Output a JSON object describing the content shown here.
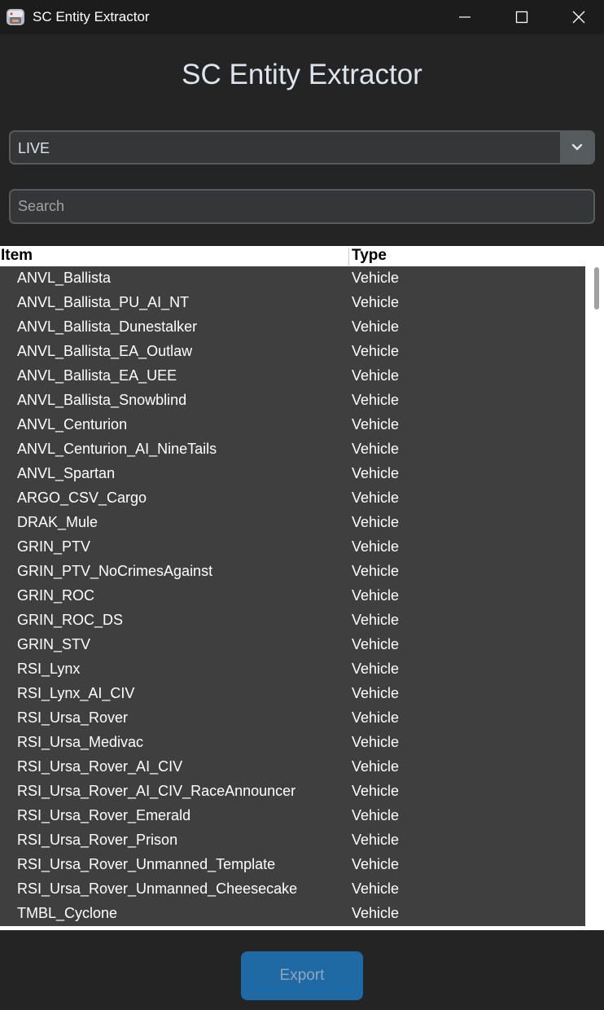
{
  "window": {
    "title": "SC Entity Extractor",
    "controls": [
      "minimize",
      "maximize",
      "close"
    ]
  },
  "heading": "SC Entity Extractor",
  "environment_select": {
    "selected": "LIVE"
  },
  "search": {
    "placeholder": "Search",
    "value": ""
  },
  "table": {
    "columns": [
      "Item",
      "Type"
    ],
    "rows": [
      {
        "item": "ANVL_Ballista",
        "type": "Vehicle"
      },
      {
        "item": "ANVL_Ballista_PU_AI_NT",
        "type": "Vehicle"
      },
      {
        "item": "ANVL_Ballista_Dunestalker",
        "type": "Vehicle"
      },
      {
        "item": "ANVL_Ballista_EA_Outlaw",
        "type": "Vehicle"
      },
      {
        "item": "ANVL_Ballista_EA_UEE",
        "type": "Vehicle"
      },
      {
        "item": "ANVL_Ballista_Snowblind",
        "type": "Vehicle"
      },
      {
        "item": "ANVL_Centurion",
        "type": "Vehicle"
      },
      {
        "item": "ANVL_Centurion_AI_NineTails",
        "type": "Vehicle"
      },
      {
        "item": "ANVL_Spartan",
        "type": "Vehicle"
      },
      {
        "item": "ARGO_CSV_Cargo",
        "type": "Vehicle"
      },
      {
        "item": "DRAK_Mule",
        "type": "Vehicle"
      },
      {
        "item": "GRIN_PTV",
        "type": "Vehicle"
      },
      {
        "item": "GRIN_PTV_NoCrimesAgainst",
        "type": "Vehicle"
      },
      {
        "item": "GRIN_ROC",
        "type": "Vehicle"
      },
      {
        "item": "GRIN_ROC_DS",
        "type": "Vehicle"
      },
      {
        "item": "GRIN_STV",
        "type": "Vehicle"
      },
      {
        "item": "RSI_Lynx",
        "type": "Vehicle"
      },
      {
        "item": "RSI_Lynx_AI_CIV",
        "type": "Vehicle"
      },
      {
        "item": "RSI_Ursa_Rover",
        "type": "Vehicle"
      },
      {
        "item": "RSI_Ursa_Medivac",
        "type": "Vehicle"
      },
      {
        "item": "RSI_Ursa_Rover_AI_CIV",
        "type": "Vehicle"
      },
      {
        "item": "RSI_Ursa_Rover_AI_CIV_RaceAnnouncer",
        "type": "Vehicle"
      },
      {
        "item": "RSI_Ursa_Rover_Emerald",
        "type": "Vehicle"
      },
      {
        "item": "RSI_Ursa_Rover_Prison",
        "type": "Vehicle"
      },
      {
        "item": "RSI_Ursa_Rover_Unmanned_Template",
        "type": "Vehicle"
      },
      {
        "item": "RSI_Ursa_Rover_Unmanned_Cheesecake",
        "type": "Vehicle"
      },
      {
        "item": "TMBL_Cyclone",
        "type": "Vehicle"
      }
    ]
  },
  "export_button": {
    "label": "Export",
    "state": "disabled"
  },
  "colors": {
    "background": "#242424",
    "titlebar": "#1c1c1c",
    "input_bg": "#343638",
    "input_border": "#565b5e",
    "table_bg": "#3f3f3f",
    "accent": "#1f6aa5"
  },
  "icons": {
    "app": "app-icon",
    "dropdown": "chevron-down-icon"
  }
}
